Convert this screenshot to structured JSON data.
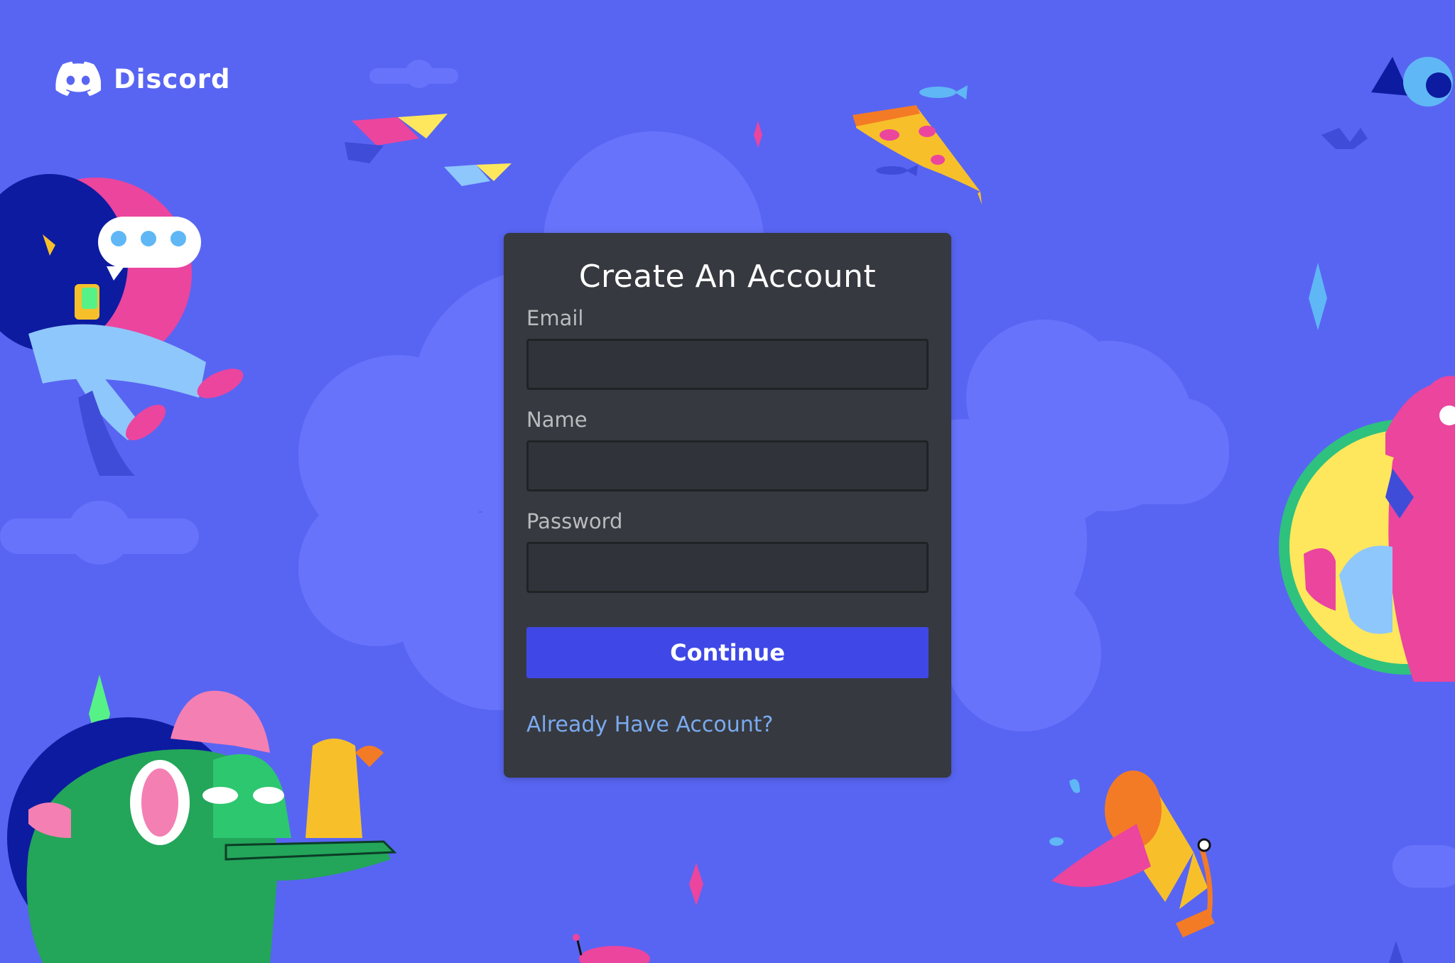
{
  "brand": {
    "name": "Discord"
  },
  "form": {
    "title": "Create An Account",
    "fields": [
      {
        "label": "Email",
        "value": "",
        "placeholder": ""
      },
      {
        "label": "Name",
        "value": "",
        "placeholder": ""
      },
      {
        "label": "Password",
        "value": "",
        "placeholder": ""
      }
    ],
    "submit_label": "Continue",
    "login_link": "Already Have Account?"
  },
  "colors": {
    "background": "#5865f2",
    "card": "#36393f",
    "input_background": "#303339",
    "button": "#3f48e6",
    "link": "#7aaaf0"
  },
  "icons": {
    "logo": "discord-logo-icon"
  }
}
